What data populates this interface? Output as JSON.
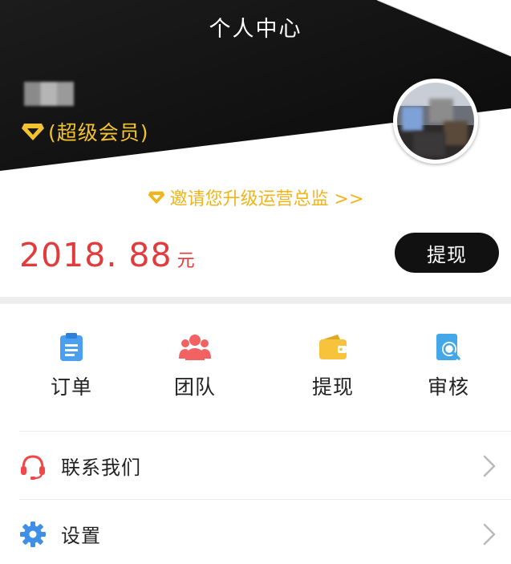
{
  "header": {
    "title": "个人中心",
    "member_label": "(超级会员)",
    "member_icon": "diamond-icon",
    "colors": {
      "bg": "#111111",
      "member": "#f2c230"
    }
  },
  "invite": {
    "text": "邀请您升级运营总监 >>",
    "icon": "diamond-icon",
    "color": "#f0b41c"
  },
  "balance": {
    "amount": "2018. 88",
    "unit": "元",
    "color": "#e23b3b",
    "withdraw_label": "提现"
  },
  "actions": [
    {
      "label": "订单",
      "icon": "clipboard-icon",
      "color": "#4a9ff0"
    },
    {
      "label": "团队",
      "icon": "team-icon",
      "color": "#f26262"
    },
    {
      "label": "提现",
      "icon": "wallet-icon",
      "color": "#f7c23c"
    },
    {
      "label": "审核",
      "icon": "review-search-icon",
      "color": "#44a8e8"
    }
  ],
  "menu": [
    {
      "label": "联系我们",
      "icon": "headset-icon",
      "color": "#f04848"
    },
    {
      "label": "设置",
      "icon": "gear-icon",
      "color": "#3f8fe8"
    }
  ]
}
